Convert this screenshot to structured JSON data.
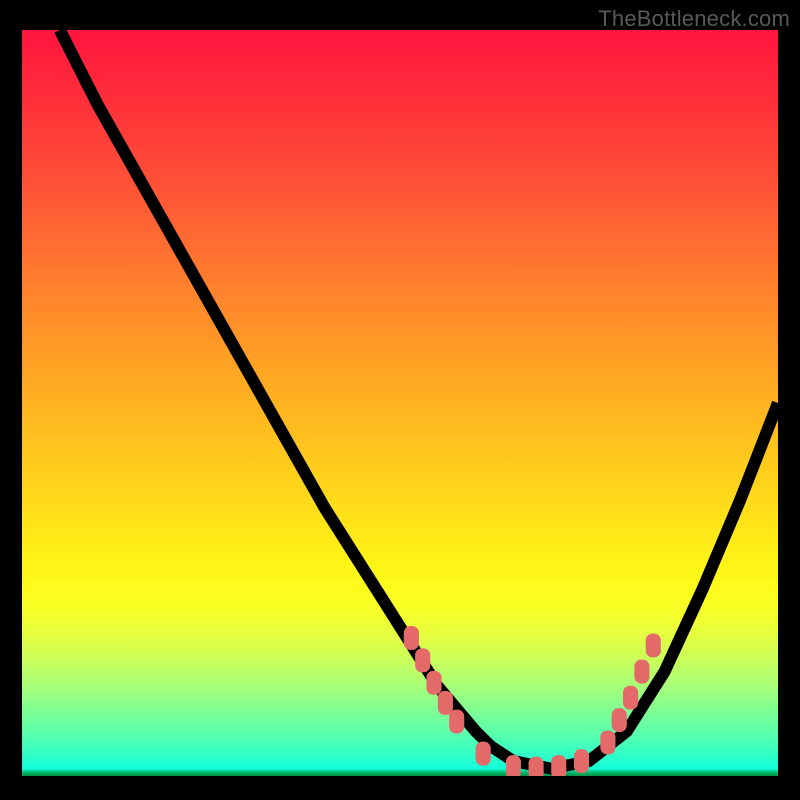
{
  "watermark": "TheBottleneck.com",
  "colors": {
    "background": "#000000",
    "marker": "#e46a6a",
    "curve": "#000000"
  },
  "chart_data": {
    "type": "line",
    "title": "",
    "xlabel": "",
    "ylabel": "",
    "xlim": [
      0,
      100
    ],
    "ylim": [
      0,
      100
    ],
    "series": [
      {
        "name": "bottleneck-curve",
        "x": [
          5,
          10,
          15,
          20,
          25,
          30,
          35,
          40,
          45,
          50,
          55,
          60,
          62,
          65,
          70,
          75,
          80,
          85,
          90,
          95,
          100
        ],
        "y": [
          100,
          90,
          81,
          72,
          63,
          54,
          45,
          36,
          28,
          20,
          12,
          6,
          4,
          2,
          1,
          2,
          6,
          14,
          25,
          37,
          50
        ]
      }
    ],
    "markers": {
      "name": "highlighted-points",
      "style": "rounded-rect",
      "points": [
        {
          "x": 51.5,
          "y": 18.5
        },
        {
          "x": 53,
          "y": 15.5
        },
        {
          "x": 54.5,
          "y": 12.5
        },
        {
          "x": 56,
          "y": 9.8
        },
        {
          "x": 57.5,
          "y": 7.3
        },
        {
          "x": 61,
          "y": 3.0
        },
        {
          "x": 65,
          "y": 1.2
        },
        {
          "x": 68,
          "y": 1.0
        },
        {
          "x": 71,
          "y": 1.2
        },
        {
          "x": 74,
          "y": 2.0
        },
        {
          "x": 77.5,
          "y": 4.5
        },
        {
          "x": 79,
          "y": 7.5
        },
        {
          "x": 80.5,
          "y": 10.5
        },
        {
          "x": 82,
          "y": 14.0
        },
        {
          "x": 83.5,
          "y": 17.5
        }
      ]
    }
  }
}
